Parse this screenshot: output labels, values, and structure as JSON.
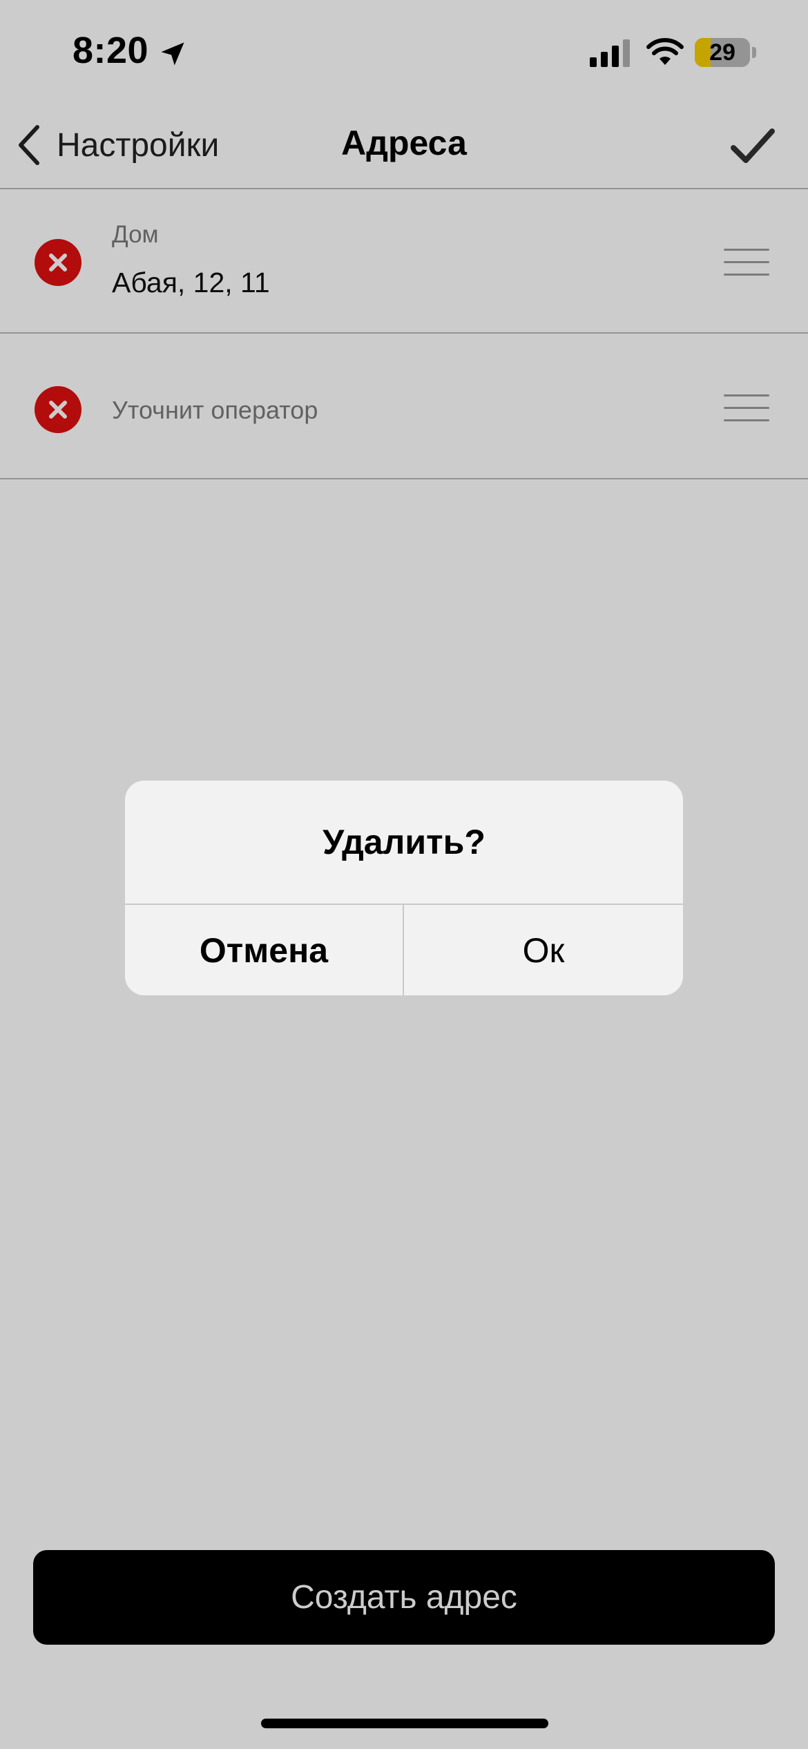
{
  "status_bar": {
    "time": "8:20",
    "battery_level": "29",
    "battery_fraction": 0.29,
    "icons": [
      "location-arrow-icon",
      "cellular-signal-icon",
      "wifi-icon",
      "battery-icon"
    ]
  },
  "nav": {
    "back_label": "Настройки",
    "title": "Адреса",
    "done_icon": "checkmark-icon"
  },
  "addresses": [
    {
      "label": "Дом",
      "value": "Абая, 12, 11"
    },
    {
      "label": "",
      "value": "",
      "placeholder": "Уточнит оператор"
    }
  ],
  "create_button_label": "Создать адрес",
  "alert": {
    "title": "Удалить?",
    "cancel_label": "Отмена",
    "ok_label": "Ок"
  },
  "colors": {
    "delete_red": "#e01010",
    "battery_yellow": "#f5cf00",
    "button_black": "#000000"
  }
}
